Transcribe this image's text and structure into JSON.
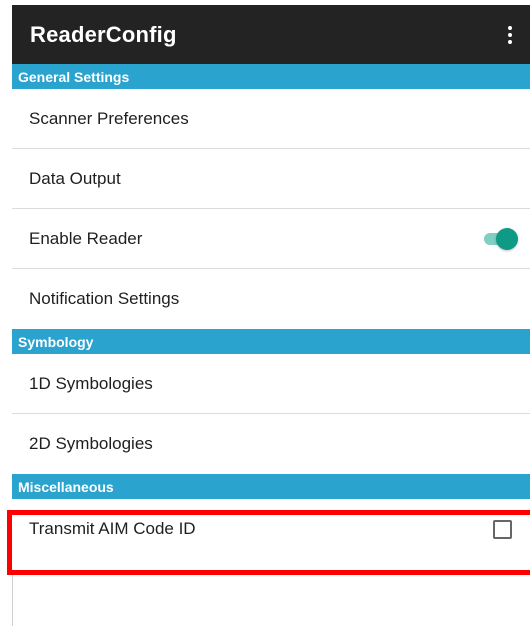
{
  "app_bar": {
    "title": "ReaderConfig",
    "overflow_icon": "more-vert-icon"
  },
  "sections": {
    "general": {
      "header": "General Settings",
      "items": [
        {
          "label": "Scanner Preferences"
        },
        {
          "label": "Data Output"
        },
        {
          "label": "Enable Reader",
          "control": "switch",
          "checked": true
        },
        {
          "label": "Notification Settings"
        }
      ]
    },
    "symbology": {
      "header": "Symbology",
      "items": [
        {
          "label": "1D Symbologies"
        },
        {
          "label": "2D Symbologies"
        }
      ]
    },
    "misc": {
      "header": "Miscellaneous",
      "items": [
        {
          "label": "Transmit AIM Code ID",
          "control": "checkbox",
          "checked": false
        }
      ]
    }
  },
  "colors": {
    "app_bar": "#232323",
    "section_header": "#2aa3cf",
    "switch_on": "#0f9a86",
    "highlight": "#ff0000"
  }
}
